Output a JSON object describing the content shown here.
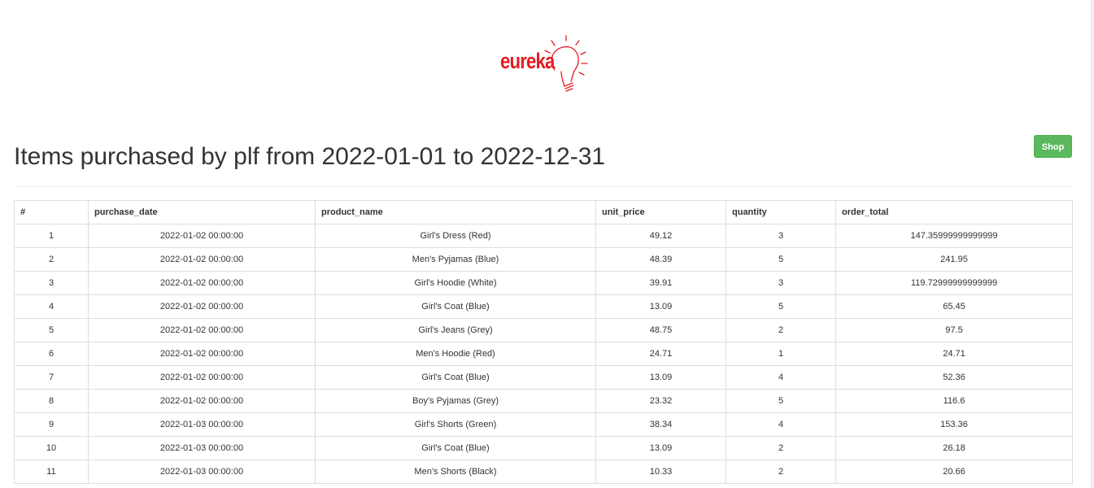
{
  "logo": {
    "text": "eureka",
    "brand_color": "#e31b23"
  },
  "header": {
    "title": "Items purchased by plf from 2022-01-01 to 2022-12-31",
    "shop_button_label": "Shop"
  },
  "colors": {
    "shop_button": "#5cb85c",
    "table_border": "#dddddd",
    "text": "#333333"
  },
  "table": {
    "columns": [
      "#",
      "purchase_date",
      "product_name",
      "unit_price",
      "quantity",
      "order_total"
    ],
    "rows": [
      [
        "1",
        "2022-01-02 00:00:00",
        "Girl's Dress (Red)",
        "49.12",
        "3",
        "147.35999999999999"
      ],
      [
        "2",
        "2022-01-02 00:00:00",
        "Men's Pyjamas (Blue)",
        "48.39",
        "5",
        "241.95"
      ],
      [
        "3",
        "2022-01-02 00:00:00",
        "Girl's Hoodie (White)",
        "39.91",
        "3",
        "119.72999999999999"
      ],
      [
        "4",
        "2022-01-02 00:00:00",
        "Girl's Coat (Blue)",
        "13.09",
        "5",
        "65.45"
      ],
      [
        "5",
        "2022-01-02 00:00:00",
        "Girl's Jeans (Grey)",
        "48.75",
        "2",
        "97.5"
      ],
      [
        "6",
        "2022-01-02 00:00:00",
        "Men's Hoodie (Red)",
        "24.71",
        "1",
        "24.71"
      ],
      [
        "7",
        "2022-01-02 00:00:00",
        "Girl's Coat (Blue)",
        "13.09",
        "4",
        "52.36"
      ],
      [
        "8",
        "2022-01-02 00:00:00",
        "Boy's Pyjamas (Grey)",
        "23.32",
        "5",
        "116.6"
      ],
      [
        "9",
        "2022-01-03 00:00:00",
        "Girl's Shorts (Green)",
        "38.34",
        "4",
        "153.36"
      ],
      [
        "10",
        "2022-01-03 00:00:00",
        "Girl's Coat (Blue)",
        "13.09",
        "2",
        "26.18"
      ],
      [
        "11",
        "2022-01-03 00:00:00",
        "Men's Shorts (Black)",
        "10.33",
        "2",
        "20.66"
      ]
    ]
  }
}
